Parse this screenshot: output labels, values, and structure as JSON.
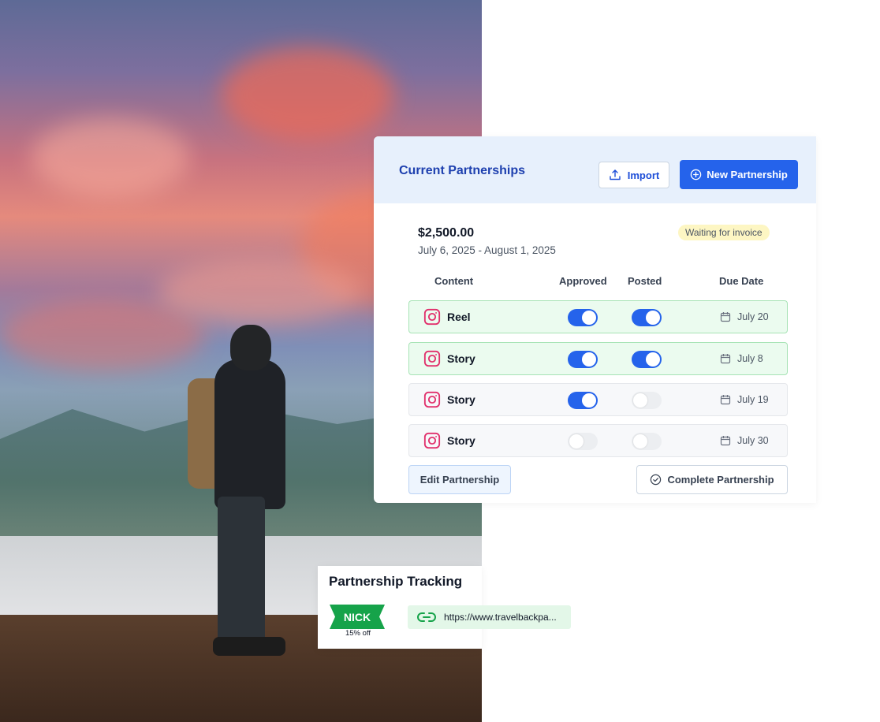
{
  "partnerships": {
    "title": "Current Partnerships",
    "import_label": "Import",
    "new_label": "New Partnership",
    "amount": "$2,500.00",
    "date_range": "July 6, 2025 - August 1, 2025",
    "status": "Waiting for invoice",
    "columns": [
      "Content",
      "Approved",
      "Posted",
      "Due Date"
    ],
    "rows": [
      {
        "label": "Reel",
        "approved": true,
        "posted": true,
        "due": "July 20"
      },
      {
        "label": "Story",
        "approved": true,
        "posted": true,
        "due": "July 8"
      },
      {
        "label": "Story",
        "approved": true,
        "posted": false,
        "due": "July 19"
      },
      {
        "label": "Story",
        "approved": false,
        "posted": false,
        "due": "July 30"
      }
    ],
    "edit_label": "Edit Partnership",
    "complete_label": "Complete Partnership"
  },
  "tracking": {
    "title": "Partnership Tracking",
    "code": "NICK",
    "discount": "15% off",
    "link": "https://www.travelbackpa..."
  },
  "colors": {
    "accent": "#2563eb",
    "title": "#1e40af",
    "success": "#16a34a",
    "instagram": "#e1306c"
  },
  "icons": {
    "import": "upload-icon",
    "new": "plus-circle-icon",
    "content": "instagram-icon",
    "due": "calendar-icon",
    "complete": "check-circle-icon",
    "link": "link-icon"
  }
}
